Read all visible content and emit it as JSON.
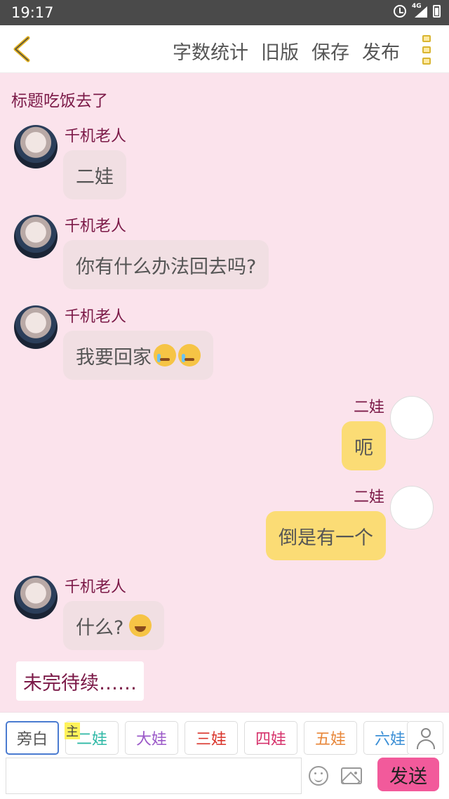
{
  "status_bar": {
    "time": "19:17",
    "network": "4G"
  },
  "header": {
    "actions": [
      "字数统计",
      "旧版",
      "保存",
      "发布"
    ]
  },
  "story": {
    "title": "标题吃饭去了"
  },
  "messages": [
    {
      "side": "left",
      "speaker": "千机老人",
      "text": "二娃",
      "emoji": ""
    },
    {
      "side": "left",
      "speaker": "千机老人",
      "text": "你有什么办法回去吗?",
      "emoji": ""
    },
    {
      "side": "left",
      "speaker": "千机老人",
      "text": "我要回家",
      "emoji": "crying-face-icons"
    },
    {
      "side": "right",
      "speaker": "二娃",
      "text": "呃",
      "emoji": ""
    },
    {
      "side": "right",
      "speaker": "二娃",
      "text": "倒是有一个",
      "emoji": ""
    },
    {
      "side": "left",
      "speaker": "千机老人",
      "text": "什么?",
      "emoji": "smiling-face-icon"
    }
  ],
  "to_be_continued": "未完待续……",
  "composer": {
    "main_tag": "主",
    "roles": [
      {
        "label": "旁白",
        "color": "#555555",
        "active": true
      },
      {
        "label": "二娃",
        "color": "#2fb8a6",
        "active": false
      },
      {
        "label": "大娃",
        "color": "#9b59c8",
        "active": false
      },
      {
        "label": "三娃",
        "color": "#d9342b",
        "active": false
      },
      {
        "label": "四娃",
        "color": "#d6336c",
        "active": false
      },
      {
        "label": "五娃",
        "color": "#e8873a",
        "active": false
      },
      {
        "label": "六娃",
        "color": "#3b8fd6",
        "active": false
      }
    ],
    "input_placeholder": "",
    "send_label": "发送"
  }
}
